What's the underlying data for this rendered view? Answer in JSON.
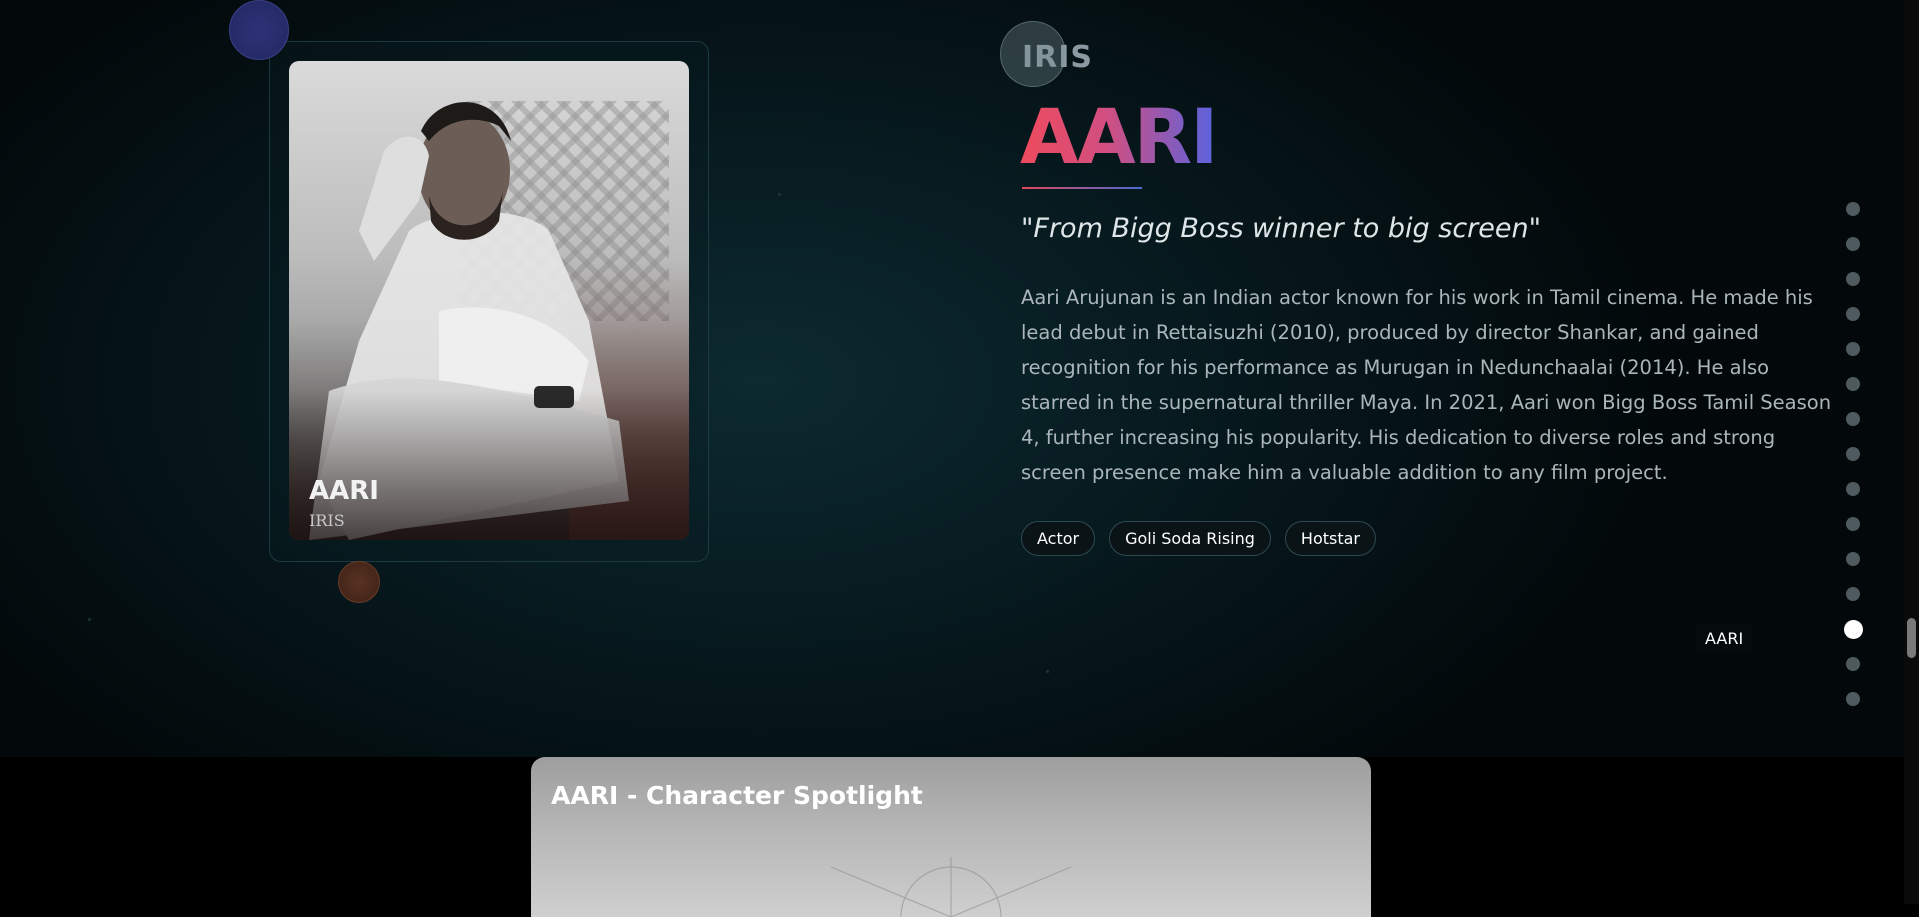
{
  "profile": {
    "card_name": "AARI",
    "card_subtitle": "IRIS",
    "eyebrow": "IRIS",
    "title": "AARI",
    "tagline": "\"From Bigg Boss winner to big screen\"",
    "bio": "Aari Arujunan is an Indian actor known for his work in Tamil cinema. He made his lead debut in Rettaisuzhi (2010), produced by director Shankar, and gained recognition for his performance as Murugan in Nedunchaalai (2014). He also starred in the supernatural thriller Maya. In 2021, Aari won Bigg Boss Tamil Season 4, further increasing his popularity. His dedication to diverse roles and strong screen presence make him a valuable addition to any film project.",
    "tags": [
      "Actor",
      "Goli Soda Rising",
      "Hotstar"
    ]
  },
  "dot_nav": {
    "count": 15,
    "active_index": 12,
    "active_label": "AARI"
  },
  "spotlight": {
    "title": "AARI - Character Spotlight"
  },
  "colors": {
    "title_gradient_start": "#ef4a5c",
    "title_gradient_end": "#5a63de",
    "background": "#071b20"
  }
}
